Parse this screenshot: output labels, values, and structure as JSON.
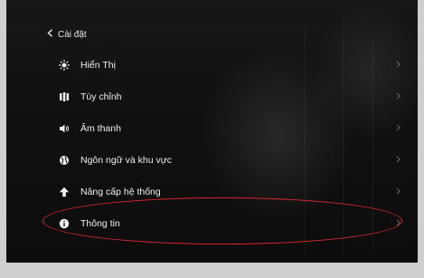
{
  "header": {
    "back_label": "Cài đặt"
  },
  "menu": {
    "items": [
      {
        "label": "Hiển Thị",
        "icon": "sun-icon"
      },
      {
        "label": "Tùy chỉnh",
        "icon": "customize-icon"
      },
      {
        "label": "Âm thanh",
        "icon": "speaker-icon"
      },
      {
        "label": "Ngôn ngữ và khu vực",
        "icon": "globe-icon"
      },
      {
        "label": "Nâng cấp hệ thống",
        "icon": "upgrade-arrow-icon"
      },
      {
        "label": "Thông tin",
        "icon": "info-icon"
      }
    ]
  },
  "annotation": {
    "color": "#d8262c"
  }
}
